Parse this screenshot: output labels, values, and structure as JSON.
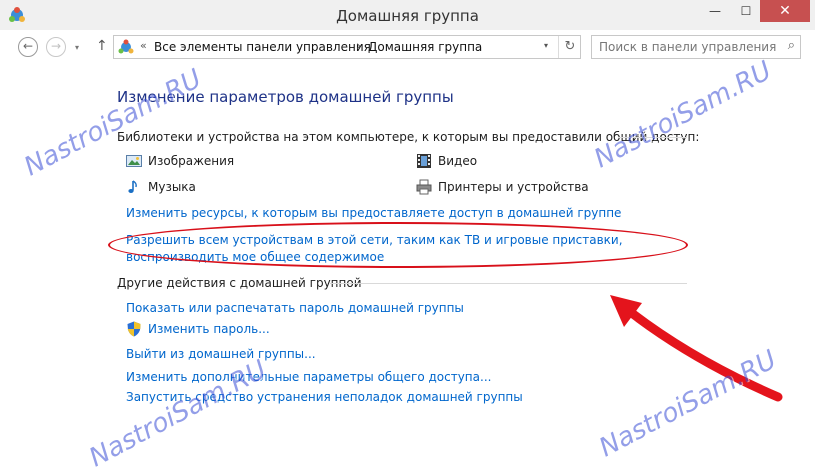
{
  "window": {
    "title": "Домашняя группа",
    "minimize": "—",
    "maximize": "☐",
    "close": "✕"
  },
  "nav": {
    "back": "←",
    "forward": "→",
    "recent": "▾",
    "up": "↑",
    "crumb_sep": "«",
    "crumbs": [
      "Все элементы панели управления",
      "Домашняя группа"
    ],
    "crumb_arrow": "›",
    "address_dropdown": "▾",
    "refresh": "↻",
    "search_placeholder": "Поиск в панели управления",
    "search_icon": "⌕"
  },
  "main": {
    "heading": "Изменение параметров домашней группы",
    "libraries_title": "Библиотеки и устройства на этом компьютере, к которым вы предоставили общий доступ:",
    "libraries": [
      {
        "label": "Изображения",
        "icon": "pictures-icon"
      },
      {
        "label": "Видео",
        "icon": "video-icon"
      },
      {
        "label": "Музыка",
        "icon": "music-icon"
      },
      {
        "label": "Принтеры и устройства",
        "icon": "printer-icon"
      }
    ],
    "change_resources_link": "Изменить ресурсы, к которым вы предоставляете доступ в домашней группе",
    "allow_devices_link": "Разрешить всем устройствам в этой сети, таким как ТВ и игровые приставки, воспроизводить мое общее содержимое",
    "other_actions_title": "Другие действия с домашней группой",
    "actions": [
      "Показать или распечатать пароль домашней группы",
      "Изменить пароль...",
      "Выйти из домашней группы...",
      "Изменить дополнительные параметры общего доступа...",
      "Запустить средство устранения неполадок домашней группы"
    ]
  },
  "watermark": "NastroiSam.RU",
  "colors": {
    "link": "#0066cc",
    "heading": "#1e3287",
    "highlight": "#d8101a",
    "watermark": "#3b4fd6",
    "close_button": "#c75050"
  }
}
